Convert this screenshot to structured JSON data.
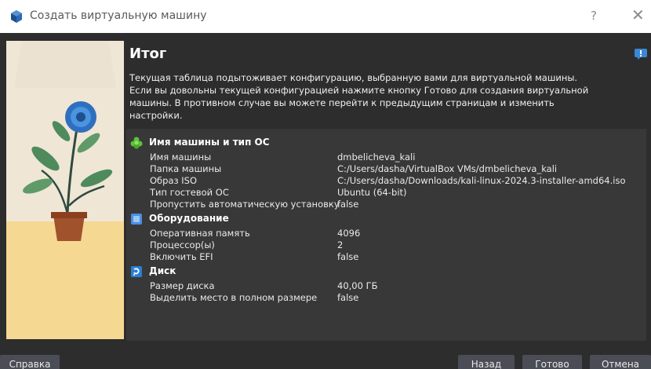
{
  "window": {
    "title": "Создать виртуальную машину",
    "help_glyph": "?",
    "close_glyph": "✕"
  },
  "page": {
    "heading": "Итог",
    "description": "Текущая таблица подытоживает конфигурацию, выбранную вами для виртуальной машины. Если вы довольны текущей конфигурацией нажмите кнопку Готово для создания виртуальной машины. В противном случае вы можете перейти к предыдущим страницам и изменить настройки."
  },
  "sections": {
    "name_os": {
      "title": "Имя машины и тип ОС",
      "icon": "green-star-icon",
      "rows": [
        {
          "key": "Имя машины",
          "value": "dmbelicheva_kali"
        },
        {
          "key": "Папка машины",
          "value": "C:/Users/dasha/VirtualBox VMs/dmbelicheva_kali"
        },
        {
          "key": "Образ ISO",
          "value": "C:/Users/dasha/Downloads/kali-linux-2024.3-installer-amd64.iso"
        },
        {
          "key": "Тип гостевой ОС",
          "value": "Ubuntu (64-bit)"
        },
        {
          "key": "Пропустить автоматическую установку",
          "value": "false"
        }
      ]
    },
    "hardware": {
      "title": "Оборудование",
      "icon": "chip-icon",
      "rows": [
        {
          "key": "Оперативная память",
          "value": "4096"
        },
        {
          "key": "Процессор(ы)",
          "value": "2"
        },
        {
          "key": "Включить EFI",
          "value": "false"
        }
      ]
    },
    "disk": {
      "title": "Диск",
      "icon": "disk-icon",
      "rows": [
        {
          "key": "Размер диска",
          "value": "40,00 ГБ"
        },
        {
          "key": "Выделить место в полном размере",
          "value": "false"
        }
      ]
    }
  },
  "buttons": {
    "help": "Справка",
    "back": "Назад",
    "finish": "Готово",
    "cancel": "Отмена"
  },
  "colors": {
    "accent": "#3a87d6",
    "background": "#2d2d2d",
    "panel": "#383838",
    "button": "#4a4d55"
  }
}
